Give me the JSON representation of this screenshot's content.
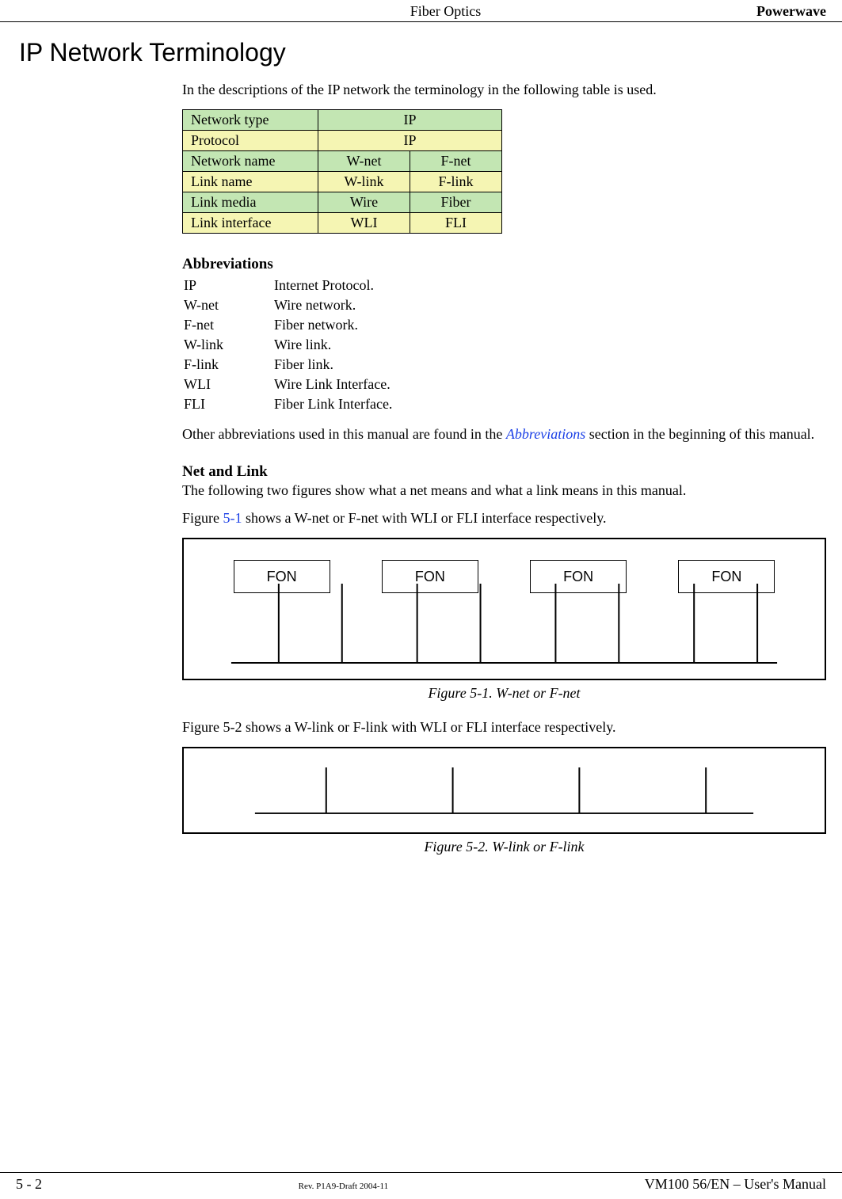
{
  "header": {
    "center": "Fiber Optics",
    "right": "Powerwave"
  },
  "heading": "IP Network Terminology",
  "intro": "In the descriptions of the IP network the terminology in the following table is used.",
  "table": {
    "rows": [
      {
        "label": "Network type",
        "c1": "IP",
        "span": true
      },
      {
        "label": "Protocol",
        "c1": "IP",
        "span": true
      },
      {
        "label": "Network name",
        "c1": "W-net",
        "c2": "F-net"
      },
      {
        "label": "Link name",
        "c1": "W-link",
        "c2": "F-link"
      },
      {
        "label": "Link media",
        "c1": "Wire",
        "c2": "Fiber"
      },
      {
        "label": "Link interface",
        "c1": "WLI",
        "c2": "FLI"
      }
    ]
  },
  "abbreviations": {
    "heading": "Abbreviations",
    "items": [
      {
        "ab": "IP",
        "def": "Internet Protocol."
      },
      {
        "ab": "W-net",
        "def": "Wire network."
      },
      {
        "ab": "F-net",
        "def": "Fiber network."
      },
      {
        "ab": "W-link",
        "def": "Wire link."
      },
      {
        "ab": "F-link",
        "def": "Fiber link."
      },
      {
        "ab": "WLI",
        "def": "Wire Link Interface."
      },
      {
        "ab": "FLI",
        "def": "Fiber Link Interface."
      }
    ],
    "note_pre": "Other abbreviations used in this manual are found in the ",
    "note_link": "Abbreviations",
    "note_post": " section in the beginning of this manual."
  },
  "netlink": {
    "heading": "Net and Link",
    "para1": "The following two figures show what a net means and what a link means in this manual.",
    "para2_pre": "Figure ",
    "para2_link": "5-1",
    "para2_post": " shows a W-net or F-net with WLI or FLI interface respectively.",
    "fon_label": "FON",
    "caption1": "Figure 5-1.  W-net or F-net",
    "para3": "Figure 5-2 shows a W-link or F-link with WLI or FLI interface respectively.",
    "caption2": "Figure 5-2.  W-link or F-link"
  },
  "footer": {
    "left": "5 - 2",
    "center": "Rev. P1A9-Draft  2004-11",
    "right": "VM100 56/EN – User's Manual"
  }
}
